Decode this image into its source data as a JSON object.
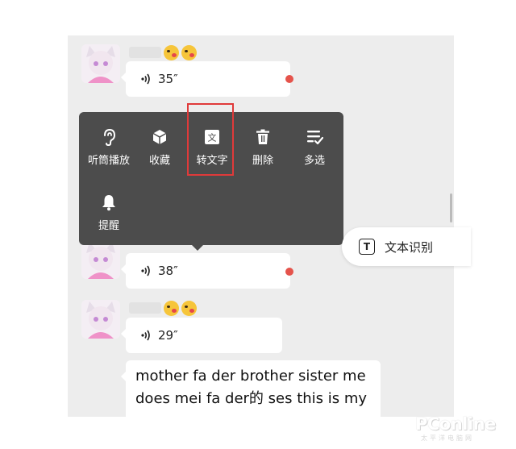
{
  "chat": {
    "messages": [
      {
        "type": "voice",
        "duration": "35″",
        "unread": true
      },
      {
        "type": "voice",
        "duration": "38″",
        "unread": true
      },
      {
        "type": "voice",
        "duration": "29″",
        "unread": false
      },
      {
        "type": "text",
        "lines": [
          "mother fa der brother sister me",
          "does mei fa der的 ses this is my"
        ]
      }
    ],
    "colors": {
      "background": "#ededed",
      "bubble": "#ffffff",
      "unread_dot": "#e5534b"
    }
  },
  "context_menu": {
    "items": [
      {
        "label": "听筒播放",
        "icon": "ear-icon"
      },
      {
        "label": "收藏",
        "icon": "cube-icon"
      },
      {
        "label": "转文字",
        "icon": "text-convert-icon",
        "highlighted": true,
        "icon_glyph": "文"
      },
      {
        "label": "删除",
        "icon": "trash-icon"
      },
      {
        "label": "多选",
        "icon": "multi-select-icon"
      },
      {
        "label": "提醒",
        "icon": "bell-icon"
      }
    ],
    "colors": {
      "background": "#4c4c4c",
      "highlight": "#e03a3a"
    }
  },
  "ocr_button": {
    "label": "文本识别",
    "icon_glyph": "T",
    "icon": "text-recognition-icon"
  },
  "watermark": {
    "brand": "PConline",
    "sub": "太平洋电脑网"
  }
}
